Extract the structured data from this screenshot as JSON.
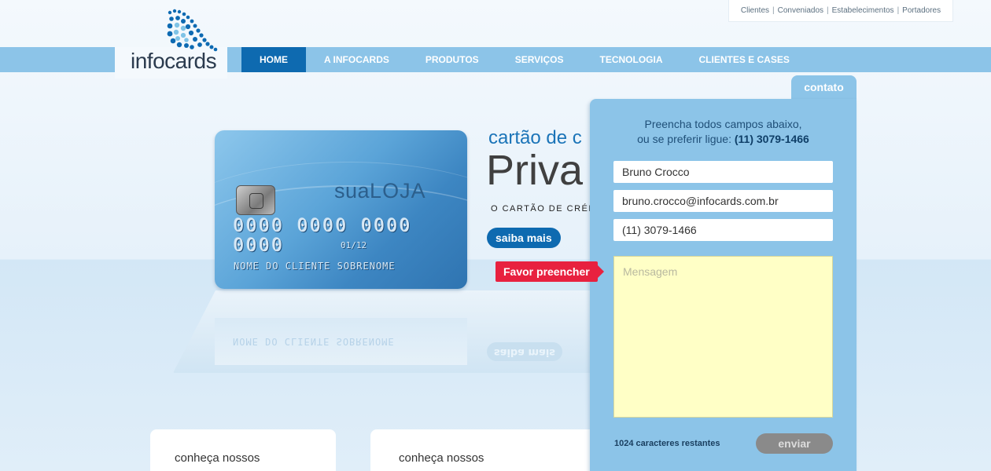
{
  "toplinks": [
    {
      "label": "Clientes"
    },
    {
      "label": "Conveniados"
    },
    {
      "label": "Estabelecimentos"
    },
    {
      "label": "Portadores"
    }
  ],
  "logo": {
    "text": "infocards"
  },
  "nav": [
    {
      "label": "HOME",
      "active": true
    },
    {
      "label": "A INFOCARDS",
      "active": false
    },
    {
      "label": "PRODUTOS",
      "active": false
    },
    {
      "label": "SERVIÇOS",
      "active": false
    },
    {
      "label": "TECNOLOGIA",
      "active": false
    },
    {
      "label": "CLIENTES E CASES",
      "active": false
    }
  ],
  "card": {
    "brand_prefix": "sua",
    "brand_suffix": "LOJA",
    "number": "0000 0000 0000 0000",
    "expiry": "01/12",
    "holder": "NOME DO CLIENTE SOBRENOME"
  },
  "hero": {
    "subtitle": "cartão de c",
    "title": "Priva",
    "tagline": "O CARTÃO DE CRÉDIT",
    "cta": "saiba mais"
  },
  "boxes": [
    {
      "kicker": "conheça nossos"
    },
    {
      "kicker": "conheça nossos"
    }
  ],
  "contact": {
    "tab": "contato",
    "intro_line1": "Preencha todos campos abaixo,",
    "intro_line2": "ou se preferir ligue: ",
    "phone": "(11) 3079-1466",
    "name_value": "Bruno Crocco",
    "email_value": "bruno.crocco@infocards.com.br",
    "phone_value": "(11) 3079-1466",
    "message_placeholder": "Mensagem",
    "counter": "1024 caracteres restantes",
    "send": "enviar",
    "error_tip": "Favor preencher"
  }
}
